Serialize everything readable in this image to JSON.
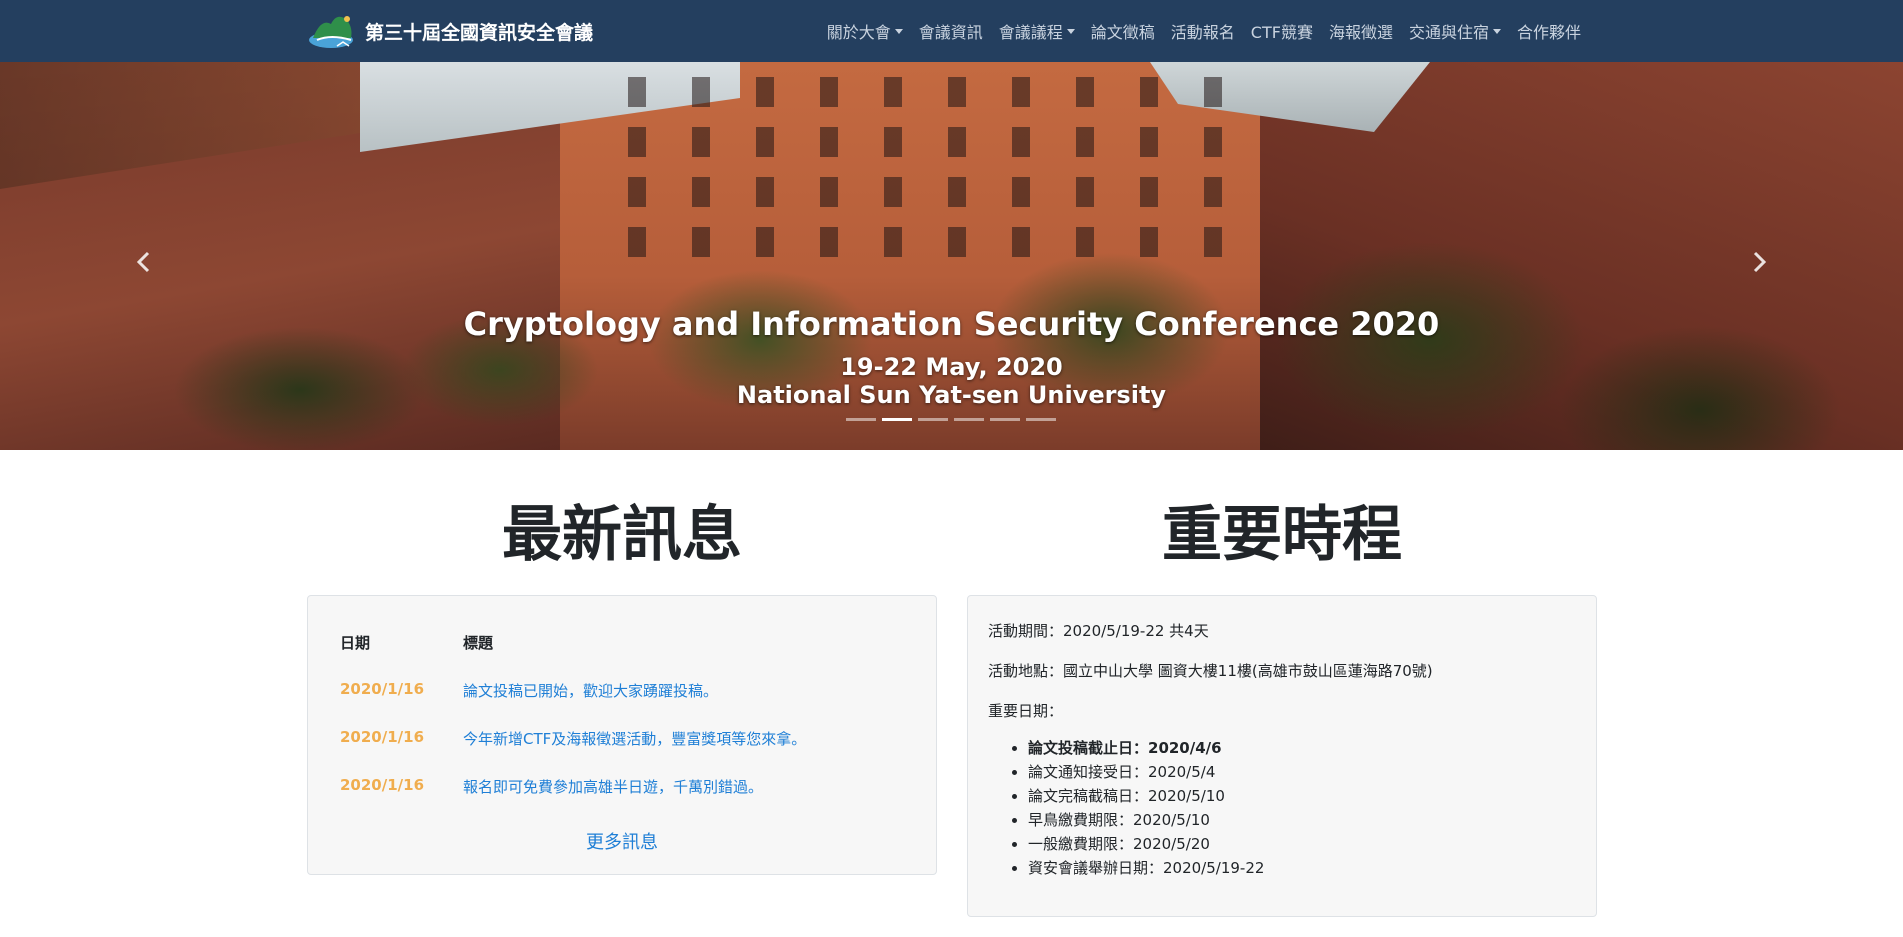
{
  "navbar": {
    "brand": "第三十屆全國資訊安全會議",
    "items": [
      {
        "label": "關於大會",
        "dropdown": true
      },
      {
        "label": "會議資訊",
        "dropdown": false
      },
      {
        "label": "會議議程",
        "dropdown": true
      },
      {
        "label": "論文徵稿",
        "dropdown": false
      },
      {
        "label": "活動報名",
        "dropdown": false
      },
      {
        "label": "CTF競賽",
        "dropdown": false
      },
      {
        "label": "海報徵選",
        "dropdown": false
      },
      {
        "label": "交通與住宿",
        "dropdown": true
      },
      {
        "label": "合作夥伴",
        "dropdown": false
      }
    ]
  },
  "hero": {
    "title": "Cryptology and Information Security Conference 2020",
    "date": "19-22 May, 2020",
    "venue": "National Sun Yat-sen University",
    "prev_icon": "chevron-left-icon",
    "next_icon": "chevron-right-icon",
    "slides_count": 6,
    "active_slide": 2
  },
  "news": {
    "heading": "最新訊息",
    "col_date": "日期",
    "col_title": "標題",
    "rows": [
      {
        "date": "2020/1/16",
        "title": "論文投稿已開始，歡迎大家踴躍投稿。"
      },
      {
        "date": "2020/1/16",
        "title": "今年新增CTF及海報徵選活動，豐富獎項等您來拿。"
      },
      {
        "date": "2020/1/16",
        "title": "報名即可免費參加高雄半日遊，千萬別錯過。"
      }
    ],
    "more": "更多訊息"
  },
  "schedule": {
    "heading": "重要時程",
    "period": "活動期間：2020/5/19-22 共4天",
    "location": "活動地點：國立中山大學 圖資大樓11樓(高雄市鼓山區蓮海路70號)",
    "dates_label": "重要日期：",
    "dates": [
      "論文投稿截止日：2020/4/6",
      "論文通知接受日：2020/5/4",
      "論文完稿截稿日：2020/5/10",
      "早鳥繳費期限：2020/5/10",
      "一般繳費期限：2020/5/20",
      "資安會議舉辦日期：2020/5/19-22"
    ]
  },
  "colors": {
    "navbar_bg": "#243f5f",
    "link": "#1f7fd6",
    "date_accent": "#f0ad4e"
  }
}
